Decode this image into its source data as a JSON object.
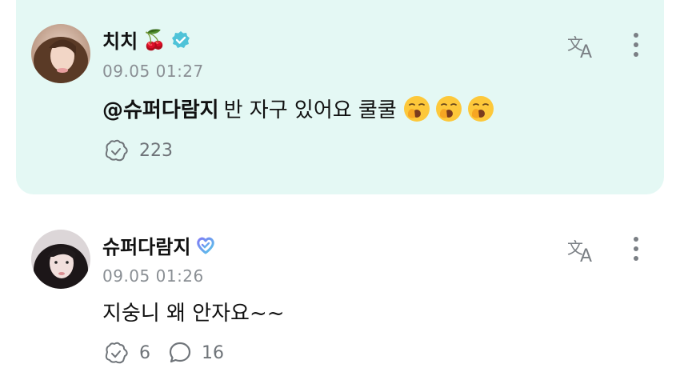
{
  "posts": [
    {
      "author": "치치",
      "author_emoji": "🍒",
      "verified": "verified-badge",
      "time": "09.05 01:27",
      "mention": "@슈퍼다람지",
      "text": "반 자구 있어요 쿨쿨",
      "emojis": [
        "yawning-face",
        "yawning-face",
        "yawning-face"
      ],
      "likes": "223",
      "highlighted": true
    },
    {
      "author": "슈퍼다람지",
      "badge": "heart-badge",
      "time": "09.05 01:26",
      "text": "지숭니 왜 안자요~~",
      "likes": "6",
      "comments": "16",
      "highlighted": false
    }
  ],
  "colors": {
    "highlight_bg": "#e4f8f4",
    "verified": "#4fc3d8",
    "muted": "#8a8f94",
    "heart_badge_a": "#7f7cf5",
    "heart_badge_b": "#58c7e8"
  },
  "icons": [
    "translate-icon",
    "more-vertical-icon",
    "like-icon",
    "comment-icon"
  ]
}
